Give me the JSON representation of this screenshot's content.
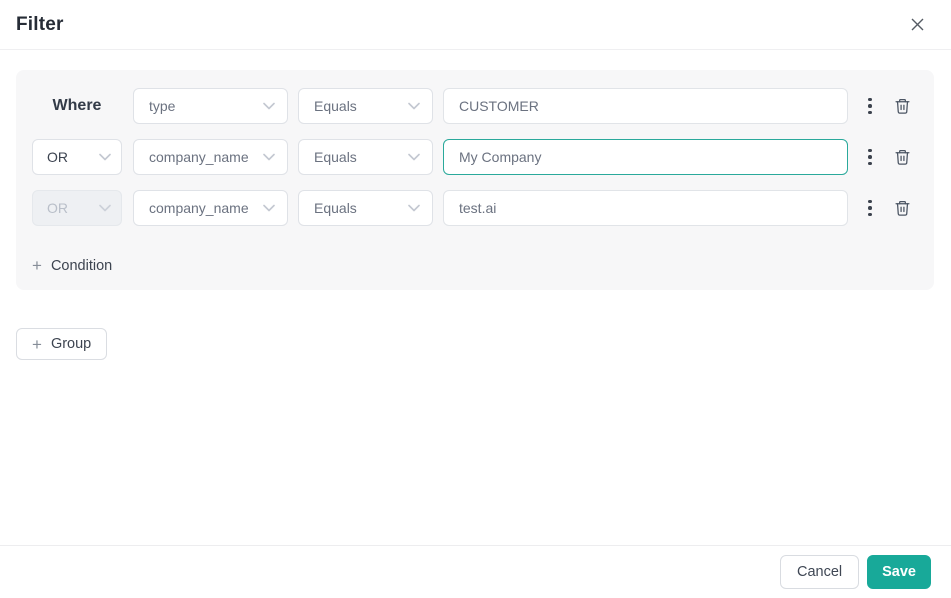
{
  "modal": {
    "title": "Filter"
  },
  "colors": {
    "accent": "#18a999",
    "focused_input_border": "#2aa99b",
    "panel_bg": "#f7f7f8"
  },
  "filter_group": {
    "rows": [
      {
        "conjunction": "Where",
        "conjunction_kind": "label",
        "field": "type",
        "operator": "Equals",
        "value": "CUSTOMER",
        "state": "default"
      },
      {
        "conjunction": "OR",
        "conjunction_kind": "select",
        "field": "company_name",
        "operator": "Equals",
        "value": "My Company",
        "state": "value-focused"
      },
      {
        "conjunction": "OR",
        "conjunction_kind": "select-disabled",
        "field": "company_name",
        "operator": "Equals",
        "value": "test.ai",
        "state": "conjunction-disabled"
      }
    ],
    "plus_sign": "+",
    "add_condition_label": "Condition"
  },
  "add_group": {
    "plus_sign": "+",
    "label": "Group"
  },
  "footer": {
    "cancel_label": "Cancel",
    "save_label": "Save"
  }
}
